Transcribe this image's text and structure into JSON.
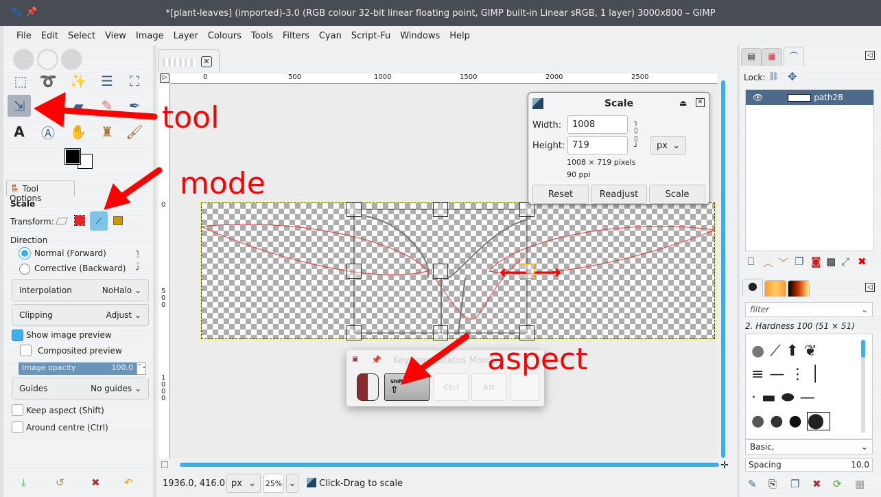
{
  "window": {
    "title": "*[plant-leaves] (imported)-3.0 (RGB colour 32-bit linear floating point, GIMP built-in Linear sRGB, 1 layer) 3000x800 – GIMP"
  },
  "menu": [
    "File",
    "Edit",
    "Select",
    "View",
    "Image",
    "Layer",
    "Colours",
    "Tools",
    "Filters",
    "Cyan",
    "Script-Fu",
    "Windows",
    "Help"
  ],
  "tool_options": {
    "tab": "Tool Options",
    "tool_name": "Scale",
    "transform_label": "Transform:",
    "direction_label": "Direction",
    "direction_options": [
      "Normal (Forward)",
      "Corrective (Backward)"
    ],
    "interpolation": {
      "label": "Interpolation",
      "value": "NoHalo"
    },
    "clipping": {
      "label": "Clipping",
      "value": "Adjust"
    },
    "show_preview": "Show image preview",
    "composited_preview": "Composited preview",
    "image_opacity": {
      "label": "Image opacity",
      "value": "100.0"
    },
    "guides": {
      "label": "Guides",
      "value": "No guides"
    },
    "keep_aspect": "Keep aspect (Shift)",
    "around_centre": "Around centre (Ctrl)"
  },
  "rulers": {
    "top": [
      "0",
      "500",
      "1000",
      "1500",
      "2000",
      "2500"
    ],
    "left": [
      "0",
      "500",
      "1000"
    ]
  },
  "scale_dialog": {
    "title": "Scale",
    "width_label": "Width:",
    "width": "1008",
    "height_label": "Height:",
    "height": "719",
    "unit": "px",
    "pixels": "1008 × 719 pixels",
    "ppi": "90 ppi",
    "reset": "Reset",
    "readjust": "Readjust",
    "scale": "Scale"
  },
  "keyboard_monitor": {
    "title": "Keyboard Status Monitor",
    "keys": [
      "Shift",
      "Ctrl",
      "Alt",
      ""
    ]
  },
  "annotations": {
    "tool": "tool",
    "mode": "mode",
    "aspect": "aspect"
  },
  "status": {
    "coords": "1936.0, 416.0",
    "unit": "px",
    "zoom": "25%",
    "message": "Click-Drag to scale"
  },
  "paths": {
    "lock_label": "Lock:",
    "items": [
      {
        "name": "path28"
      }
    ]
  },
  "brushes": {
    "filter_placeholder": "filter",
    "current": "2. Hardness 100 (51 × 51)",
    "tag": "Basic,",
    "spacing_label": "Spacing",
    "spacing": "10.0"
  }
}
